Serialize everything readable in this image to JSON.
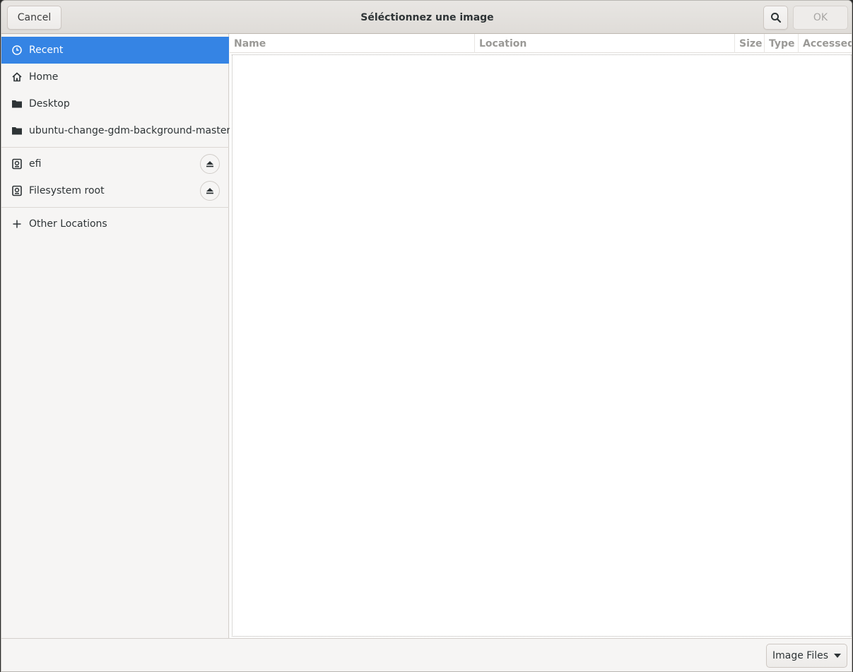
{
  "header": {
    "title": "Séléctionnez une image",
    "cancel_label": "Cancel",
    "ok_label": "OK",
    "search_icon": "search-icon"
  },
  "sidebar": {
    "items": [
      {
        "label": "Recent",
        "icon": "clock-icon",
        "selected": true
      },
      {
        "label": "Home",
        "icon": "home-icon"
      },
      {
        "label": "Desktop",
        "icon": "folder-icon"
      },
      {
        "label": "ubuntu-change-gdm-background-master",
        "icon": "folder-icon"
      },
      {
        "label": "efi",
        "icon": "drive-icon",
        "eject": true
      },
      {
        "label": "Filesystem root",
        "icon": "drive-icon",
        "eject": true
      },
      {
        "label": "Other Locations",
        "icon": "plus-icon"
      }
    ]
  },
  "columns": [
    "Name",
    "Location",
    "Size",
    "Type",
    "Accessed"
  ],
  "footer": {
    "filter_label": "Image Files",
    "filter_icon": "caret-down-icon"
  },
  "colors": {
    "accent": "#3584e4",
    "headerbar": "#e2e0dd",
    "column_header_text": "#9a9996"
  }
}
